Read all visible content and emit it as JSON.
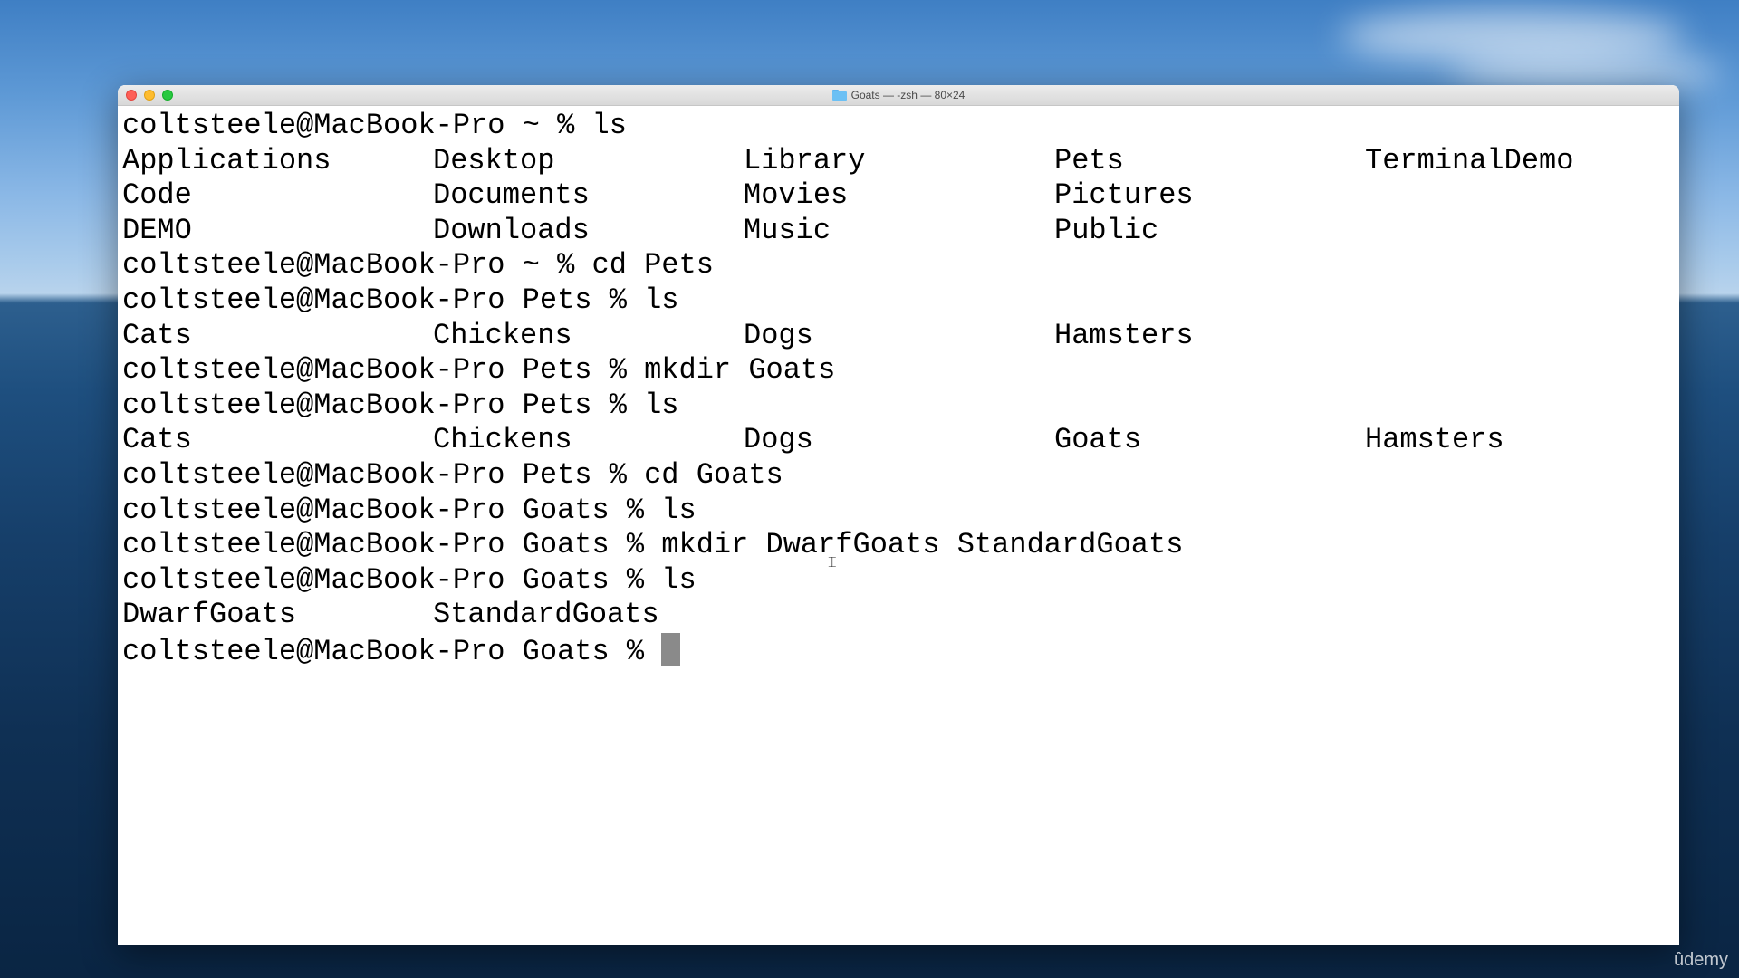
{
  "window": {
    "title": "Goats — -zsh — 80×24"
  },
  "terminal": {
    "lines": [
      {
        "type": "prompt",
        "text": "coltsteele@MacBook-Pro ~ % ls"
      },
      {
        "type": "ls",
        "cols": [
          "Applications",
          "Desktop",
          "Library",
          "Pets",
          "TerminalDemo"
        ]
      },
      {
        "type": "ls",
        "cols": [
          "Code",
          "Documents",
          "Movies",
          "Pictures"
        ]
      },
      {
        "type": "ls",
        "cols": [
          "DEMO",
          "Downloads",
          "Music",
          "Public"
        ]
      },
      {
        "type": "prompt",
        "text": "coltsteele@MacBook-Pro ~ % cd Pets"
      },
      {
        "type": "prompt",
        "text": "coltsteele@MacBook-Pro Pets % ls"
      },
      {
        "type": "ls",
        "cols": [
          "Cats",
          "Chickens",
          "Dogs",
          "Hamsters"
        ]
      },
      {
        "type": "prompt",
        "text": "coltsteele@MacBook-Pro Pets % mkdir Goats"
      },
      {
        "type": "prompt",
        "text": "coltsteele@MacBook-Pro Pets % ls"
      },
      {
        "type": "ls",
        "cols": [
          "Cats",
          "Chickens",
          "Dogs",
          "Goats",
          "Hamsters"
        ]
      },
      {
        "type": "prompt",
        "text": "coltsteele@MacBook-Pro Pets % cd Goats"
      },
      {
        "type": "prompt",
        "text": "coltsteele@MacBook-Pro Goats % ls"
      },
      {
        "type": "prompt",
        "text": "coltsteele@MacBook-Pro Goats % mkdir DwarfGoats StandardGoats"
      },
      {
        "type": "prompt",
        "text": "coltsteele@MacBook-Pro Goats % ls"
      },
      {
        "type": "ls",
        "cols": [
          "DwarfGoats",
          "StandardGoats"
        ]
      }
    ],
    "current_prompt": "coltsteele@MacBook-Pro Goats % "
  },
  "watermark": "ûdemy",
  "colors": {
    "terminal_background": "#ffffff",
    "terminal_text": "#000000",
    "cursor": "#8a8a8a"
  },
  "icons": {
    "title_icon": "folder-icon",
    "pointer": "i-beam-cursor-icon"
  }
}
